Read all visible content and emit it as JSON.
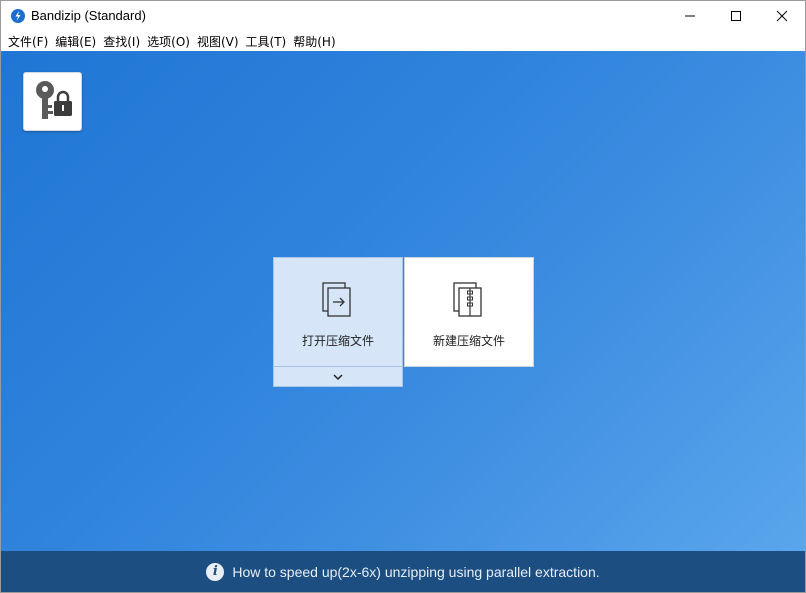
{
  "window": {
    "title": "Bandizip (Standard)"
  },
  "menu": {
    "items": [
      {
        "label": "文件(F)",
        "name": "menu-file"
      },
      {
        "label": "编辑(E)",
        "name": "menu-edit"
      },
      {
        "label": "查找(I)",
        "name": "menu-find"
      },
      {
        "label": "选项(O)",
        "name": "menu-options"
      },
      {
        "label": "视图(V)",
        "name": "menu-view"
      },
      {
        "label": "工具(T)",
        "name": "menu-tools"
      },
      {
        "label": "帮助(H)",
        "name": "menu-help"
      }
    ]
  },
  "main": {
    "tiles": {
      "open_label": "打开压缩文件",
      "new_label": "新建压缩文件"
    }
  },
  "status": {
    "tip": "How to speed up(2x-6x) unzipping using parallel extraction.",
    "info_glyph": "i"
  },
  "colors": {
    "accent": "#1a6fd1",
    "status_bar": "#1c4e82",
    "tile_selected": "#d6e6f8"
  },
  "icons": {
    "app": "bandizip-logo-icon",
    "lock": "password-lock-icon",
    "open": "open-archive-icon",
    "new": "new-archive-icon",
    "dropdown": "chevron-down-icon",
    "info": "info-icon"
  }
}
